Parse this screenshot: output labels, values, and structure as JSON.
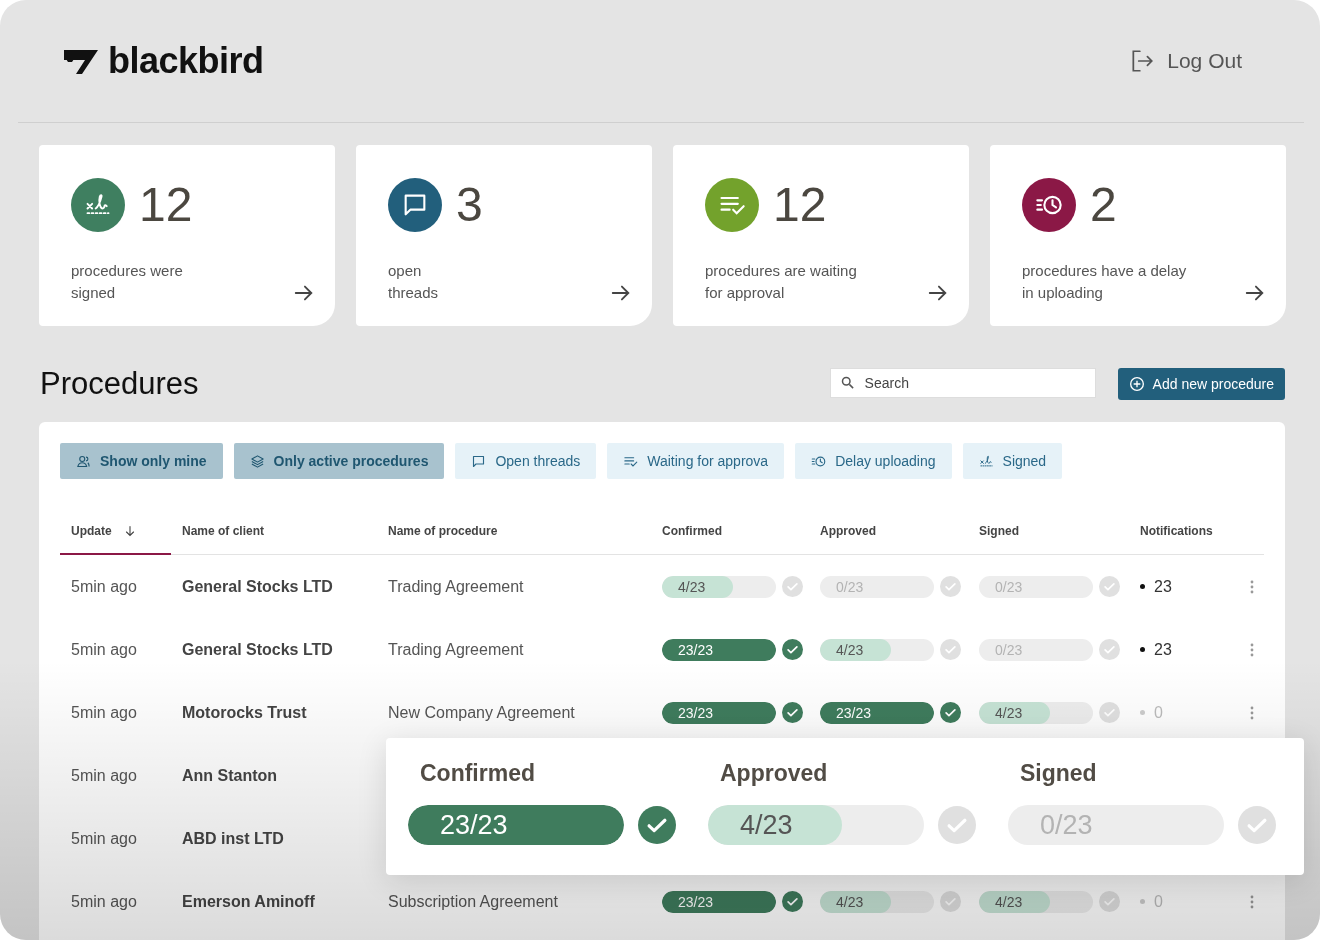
{
  "brand": "blackbird",
  "logout": "Log Out",
  "stats": [
    {
      "kind": "signed",
      "value": "12",
      "label": "procedures were\nsigned"
    },
    {
      "kind": "threads",
      "value": "3",
      "label": "open\nthreads"
    },
    {
      "kind": "waiting",
      "value": "12",
      "label": "procedures are waiting\nfor approval"
    },
    {
      "kind": "delay",
      "value": "2",
      "label": "procedures have a delay\nin uploading"
    }
  ],
  "section_title": "Procedures",
  "search": {
    "placeholder": "Search"
  },
  "add_button": "Add new procedure",
  "filters": [
    {
      "kind": "mine",
      "label": "Show only mine",
      "selected": true
    },
    {
      "kind": "active",
      "label": "Only active procedures",
      "selected": true
    },
    {
      "kind": "threads",
      "label": "Open threads",
      "selected": false
    },
    {
      "kind": "waiting",
      "label": "Waiting for approva",
      "selected": false
    },
    {
      "kind": "delay",
      "label": "Delay uploading",
      "selected": false
    },
    {
      "kind": "signed",
      "label": "Signed",
      "selected": false
    }
  ],
  "columns": [
    {
      "label": "Update",
      "sorted": true
    },
    {
      "label": "Name of client",
      "sorted": false
    },
    {
      "label": "Name of procedure",
      "sorted": false
    },
    {
      "label": "Confirmed",
      "sorted": false
    },
    {
      "label": "Approved",
      "sorted": false
    },
    {
      "label": "Signed",
      "sorted": false
    },
    {
      "label": "Notifications",
      "sorted": false
    }
  ],
  "rows": [
    {
      "update": "5min ago",
      "client": "General Stocks LTD",
      "procedure": "Trading Agreement",
      "confirmed": {
        "label": "4/23",
        "level": 0.62
      },
      "approved": {
        "label": "0/23",
        "level": 0
      },
      "signed": {
        "label": "0/23",
        "level": 0
      },
      "notifications": {
        "label": "23",
        "active": true
      }
    },
    {
      "update": "5min ago",
      "client": "General Stocks LTD",
      "procedure": "Trading Agreement",
      "confirmed": {
        "label": "23/23",
        "level": 1
      },
      "approved": {
        "label": "4/23",
        "level": 0.62
      },
      "signed": {
        "label": "0/23",
        "level": 0
      },
      "notifications": {
        "label": "23",
        "active": true
      }
    },
    {
      "update": "5min ago",
      "client": "Motorocks Trust",
      "procedure": "New Company Agreement",
      "confirmed": {
        "label": "23/23",
        "level": 1
      },
      "approved": {
        "label": "23/23",
        "level": 1
      },
      "signed": {
        "label": "4/23",
        "level": 0.62
      },
      "notifications": {
        "label": "0",
        "active": false
      }
    },
    {
      "update": "5min ago",
      "client": "Ann Stanton"
    },
    {
      "update": "5min ago",
      "client": "ABD inst LTD"
    },
    {
      "update": "5min ago",
      "client": "Emerson Aminoff",
      "procedure": "Subscription Agreement",
      "confirmed": {
        "label": "23/23",
        "level": 1
      },
      "approved": {
        "label": "4/23",
        "level": 0.62
      },
      "signed": {
        "label": "4/23",
        "level": 0.62
      },
      "notifications": {
        "label": "0",
        "active": false
      }
    }
  ],
  "popover": {
    "items": [
      {
        "title": "Confirmed",
        "label": "23/23",
        "level": 1
      },
      {
        "title": "Approved",
        "label": "4/23",
        "level": 0.62
      },
      {
        "title": "Signed",
        "label": "0/23",
        "level": 0
      }
    ]
  }
}
